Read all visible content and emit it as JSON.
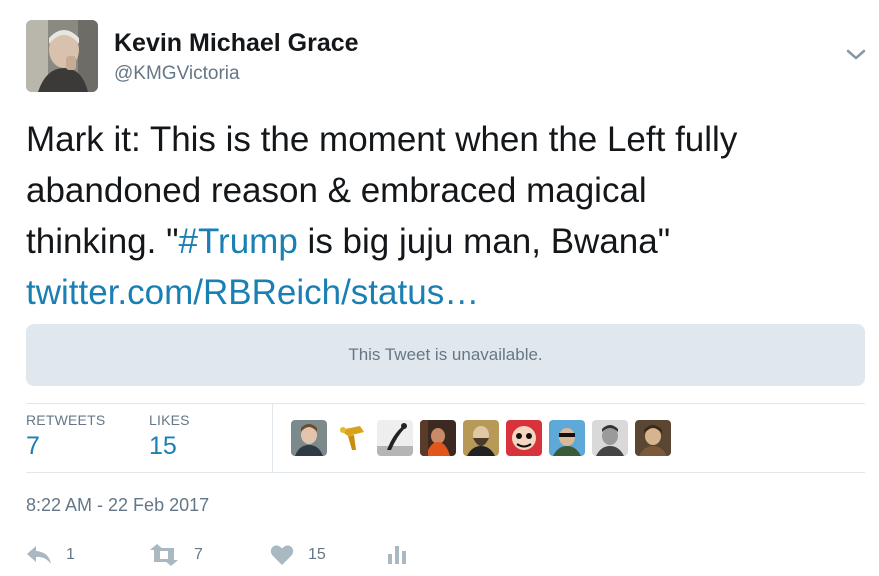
{
  "user": {
    "name": "Kevin Michael Grace",
    "handle": "@KMGVictoria"
  },
  "tweet": {
    "line1": "Mark it: This is the moment when the Left fully",
    "line2": "abandoned reason & embraced magical",
    "line3_pre": "thinking. \"",
    "hashtag": "#Trump",
    "line3_post": " is big juju man, Bwana\"",
    "link": "twitter.com/RBReich/status…"
  },
  "quoted": {
    "message": "This Tweet is unavailable."
  },
  "stats": {
    "retweets_label": "RETWEETS",
    "retweets": "7",
    "likes_label": "LIKES",
    "likes": "15"
  },
  "timestamp": "8:22 AM - 22 Feb 2017",
  "actions": {
    "reply_count": "1",
    "retweet_count": "7",
    "like_count": "15"
  },
  "colors": {
    "link": "#1a7fb3",
    "muted": "#657786",
    "divider": "#e1e8ed",
    "text": "#14171a"
  }
}
